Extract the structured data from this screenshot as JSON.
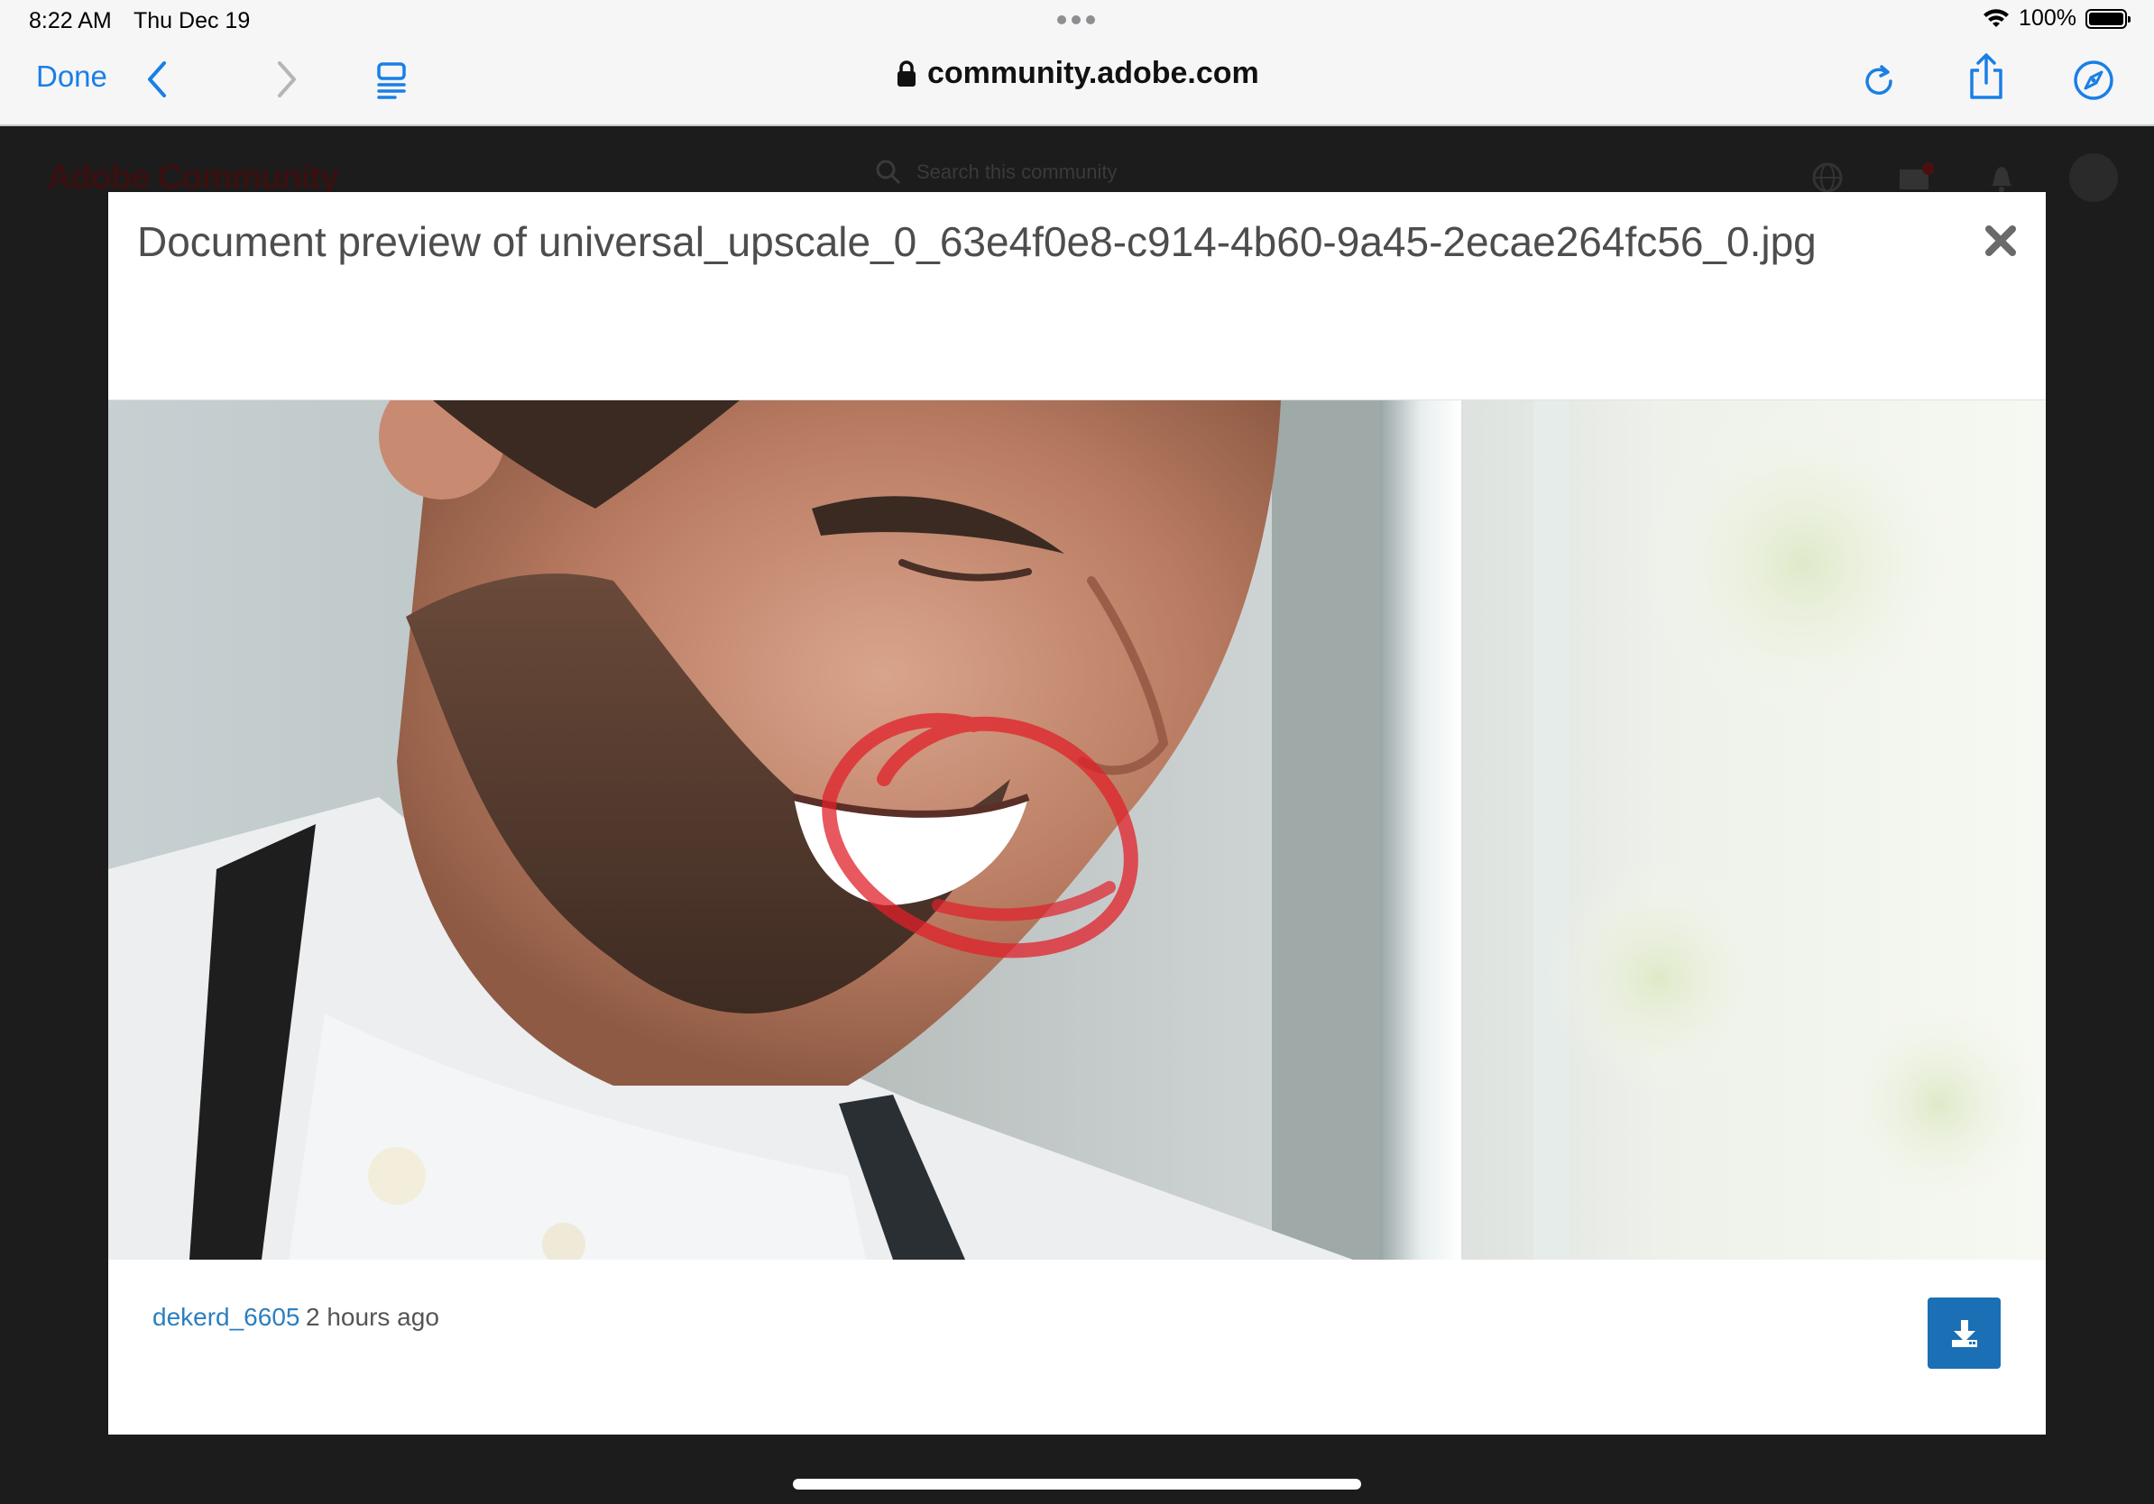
{
  "status_bar": {
    "time": "8:22 AM",
    "date": "Thu Dec 19",
    "battery": "100%"
  },
  "toolbar": {
    "done_label": "Done",
    "url": "community.adobe.com",
    "icons": [
      "back-icon",
      "forward-icon",
      "reader-icon",
      "reload-icon",
      "share-icon",
      "compass-icon"
    ]
  },
  "background_page": {
    "logo": "Adobe Community",
    "search_placeholder": "Search this community"
  },
  "modal": {
    "title": "Document preview of universal_upscale_0_63e4f0e8-c914-4b60-9a45-2ecae264fc56_0.jpg",
    "author": "dekerd_6605",
    "time_ago": "2 hours ago",
    "colors": {
      "download_button": "#1a6fb5",
      "author_link": "#2c7fbf",
      "annotation_circle": "#e0202a"
    }
  }
}
